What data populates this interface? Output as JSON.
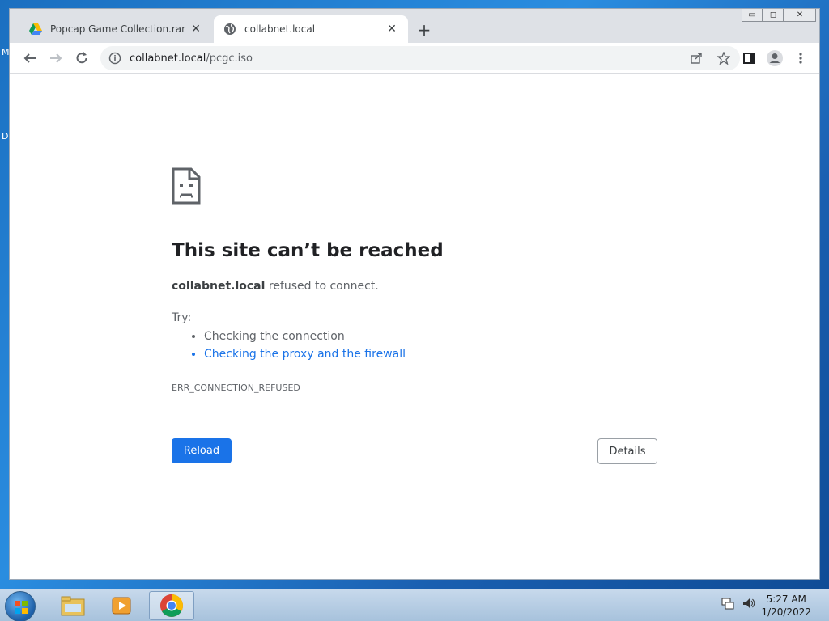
{
  "desktop": {
    "edge_glyph_top": "M",
    "edge_glyph_mid": "D"
  },
  "browser": {
    "tabs": [
      {
        "title": "Popcap Game Collection.rar - Goo",
        "icon": "google-drive-icon",
        "active": false
      },
      {
        "title": "collabnet.local",
        "icon": "globe-icon",
        "active": true
      }
    ],
    "window_controls": {
      "minimize": "▭",
      "maximize": "◻",
      "close": "✕"
    },
    "omnibox": {
      "host": "collabnet.local",
      "path": "/pcgc.iso"
    }
  },
  "error_page": {
    "title": "This site can’t be reached",
    "host": "collabnet.local",
    "message_suffix": " refused to connect.",
    "try_label": "Try:",
    "suggestions": [
      {
        "text": "Checking the connection",
        "link": false
      },
      {
        "text": "Checking the proxy and the firewall",
        "link": true
      }
    ],
    "error_code": "ERR_CONNECTION_REFUSED",
    "reload_label": "Reload",
    "details_label": "Details"
  },
  "taskbar": {
    "apps": [
      "explorer-icon",
      "media-player-icon",
      "chrome-icon"
    ],
    "time": "5:27 AM",
    "date": "1/20/2022"
  },
  "colors": {
    "primary_button": "#1a73e8",
    "link": "#1a73e8",
    "tabstrip": "#dee1e6"
  }
}
